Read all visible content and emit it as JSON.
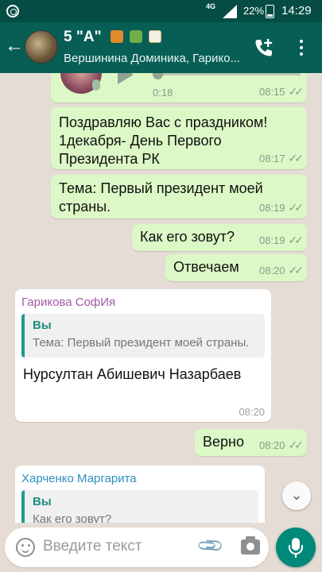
{
  "status_bar": {
    "network": "4G",
    "battery_pct": "22%",
    "time": "14:29"
  },
  "header": {
    "title": "5 \"А\"",
    "subtitle": "Вершинина Доминика, Гарико..."
  },
  "messages": [
    {
      "type": "voice",
      "direction": "out",
      "duration": "0:18",
      "time": "08:15"
    },
    {
      "type": "text",
      "direction": "out",
      "text": "Поздравляю Вас с праздником! 1декабря- День Первого Президента РК",
      "time": "08:17"
    },
    {
      "type": "text",
      "direction": "out",
      "text": "Тема: Первый президент моей страны.",
      "time": "08:19"
    },
    {
      "type": "text",
      "direction": "out",
      "text": "Как его зовут?",
      "time": "08:19"
    },
    {
      "type": "text",
      "direction": "out",
      "text": "Отвечаем",
      "time": "08:20"
    },
    {
      "type": "reply",
      "direction": "in",
      "sender": "Гарикова СофИя",
      "sender_color": "#a05aa6",
      "quote_author": "Вы",
      "quote_text": "Тема: Первый президент моей страны.",
      "text": "Нурсултан Абишевич Назарбаев",
      "time": "08:20"
    },
    {
      "type": "text",
      "direction": "out",
      "text": "Верно",
      "time": "08:20"
    },
    {
      "type": "reply",
      "direction": "in",
      "sender": "Харченко Маргарита",
      "sender_color": "#2f8fbf",
      "quote_author": "Вы",
      "quote_text": "Как его зовут?"
    }
  ],
  "input": {
    "placeholder": "Введите текст"
  },
  "colors": {
    "header": "#075e54",
    "outgoing_bubble": "#dcf8c6",
    "incoming_bubble": "#ffffff",
    "accent": "#00897b"
  },
  "icons": [
    "chrome-icon",
    "back-arrow-icon",
    "add-call-icon",
    "more-vert-icon",
    "play-icon",
    "mic-icon",
    "double-check-icon",
    "chevron-down-icon",
    "emoji-icon",
    "attach-icon",
    "camera-icon"
  ]
}
